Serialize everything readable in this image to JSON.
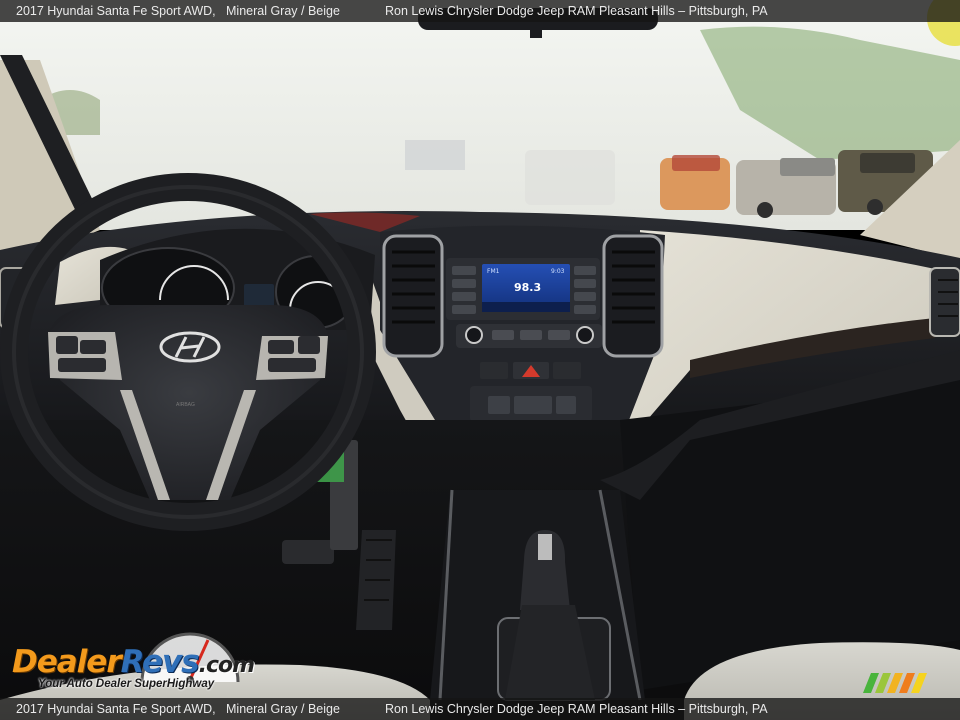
{
  "caption": {
    "model": "2017 Hyundai Santa Fe Sport AWD,",
    "color": "Mineral Gray / Beige",
    "dealer": "Ron Lewis Chrysler Dodge Jeep RAM Pleasant Hills – Pittsburgh, PA"
  },
  "watermark": {
    "brand_part1": "Dealer",
    "brand_part2": "Revs",
    "brand_part3": ".com",
    "tagline": "Your Auto Dealer SuperHighway"
  },
  "radio": {
    "frequency": "98.3",
    "band": "FM1",
    "time": "9:03"
  },
  "airbag": "AIRBAG",
  "colors": {
    "caption_bg": "#141414",
    "caption_text": "#eaeaea",
    "dash_dark": "#1c1e22",
    "dash_beige": "#d9d6cb",
    "screen_blue": "#1d3f9a",
    "logo_orange": "#f39a1c",
    "logo_blue": "#2f6fb8"
  }
}
